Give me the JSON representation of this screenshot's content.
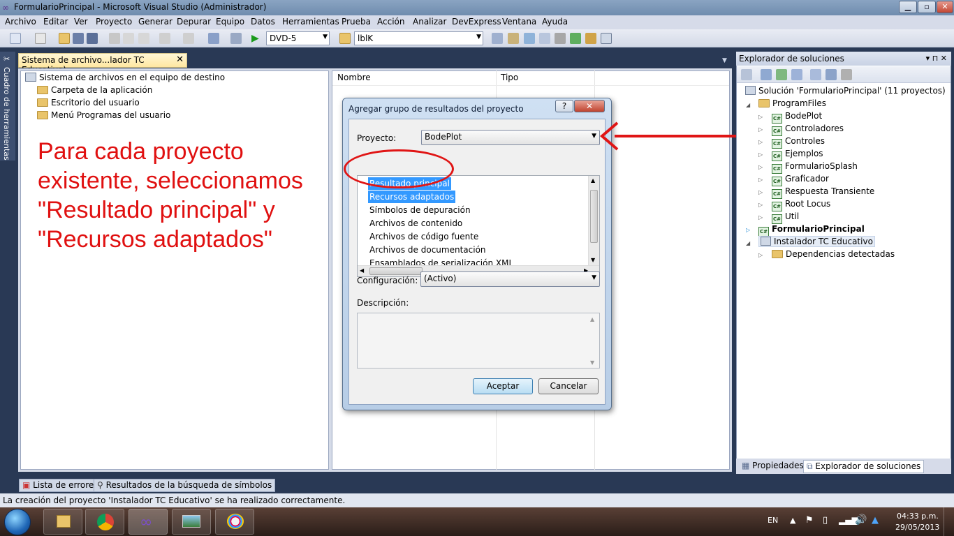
{
  "window": {
    "title": "FormularioPrincipal - Microsoft Visual Studio (Administrador)"
  },
  "menu": [
    "Archivo",
    "Editar",
    "Ver",
    "Proyecto",
    "Generar",
    "Depurar",
    "Equipo",
    "Datos",
    "Herramientas",
    "Prueba",
    "Acción",
    "Analizar",
    "DevExpress",
    "Ventana",
    "Ayuda"
  ],
  "toolbar": {
    "config_combo": "DVD-5",
    "find_combo": "lblK"
  },
  "toolbox": {
    "label": "Cuadro de herramientas"
  },
  "document_tab": {
    "label": "Sistema de archivo...lador TC Educativo)",
    "close": "✕"
  },
  "filesystem_tree": {
    "root": "Sistema de archivos en el equipo de destino",
    "items": [
      "Carpeta de la aplicación",
      "Escritorio del usuario",
      "Menú Programas del usuario"
    ]
  },
  "annotation": "Para cada proyecto existente, seleccionamos \"Resultado principal\" y \"Recursos adaptados\"",
  "columns": {
    "name": "Nombre",
    "type": "Tipo"
  },
  "dialog": {
    "title": "Agregar grupo de resultados del proyecto",
    "help": "?",
    "close": "✕",
    "project_label": "Proyecto:",
    "project_value": "BodePlot",
    "outputs": [
      "Resultado principal",
      "Recursos adaptados",
      "Símbolos de depuración",
      "Archivos de contenido",
      "Archivos de código fuente",
      "Archivos de documentación",
      "Ensamblados de serialización XML"
    ],
    "config_label": "Configuración:",
    "config_value": "(Activo)",
    "desc_label": "Descripción:",
    "ok": "Aceptar",
    "cancel": "Cancelar"
  },
  "solution_explorer": {
    "header": "Explorador de soluciones",
    "pin": "▾ ⊓ ✕",
    "solution": "Solución 'FormularioPrincipal' (11 proyectos)",
    "program_files": "ProgramFiles",
    "projects": [
      "BodePlot",
      "Controladores",
      "Controles",
      "Ejemplos",
      "FormularioSplash",
      "Graficador",
      "Respuesta Transiente",
      "Root Locus",
      "Util"
    ],
    "startup_project": "FormularioPrincipal",
    "installer": "Instalador TC Educativo",
    "dependencies": "Dependencias detectadas",
    "tabs": [
      "Propiedades",
      "Explorador de soluciones"
    ]
  },
  "bottom_tabs": [
    "Lista de errores",
    "Resultados de la búsqueda de símbolos"
  ],
  "status": "La creación del proyecto 'Instalador TC Educativo' se ha realizado correctamente.",
  "taskbar": {
    "lang": "EN",
    "time": "04:33 p.m.",
    "date": "29/05/2013"
  },
  "colors": {
    "annotation_red": "#e01010",
    "selection_blue": "#3399ff",
    "vs_dark_blue": "#293955"
  }
}
